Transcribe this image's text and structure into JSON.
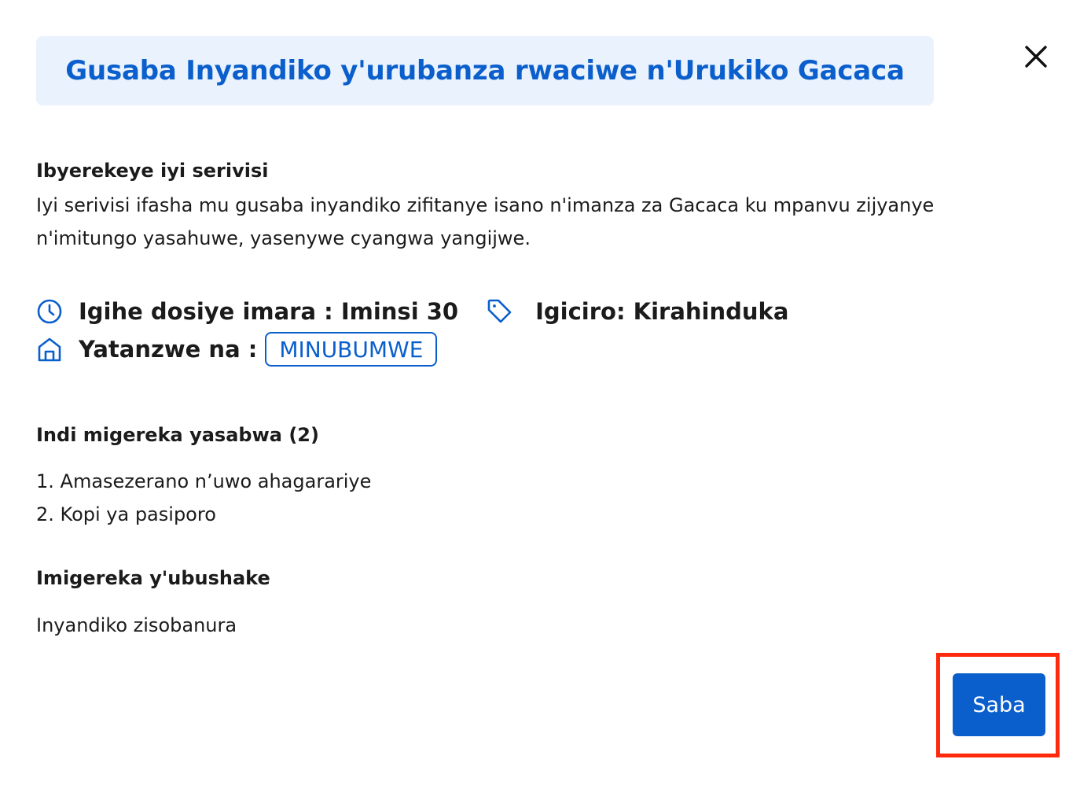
{
  "modal": {
    "title": "Gusaba Inyandiko y'urubanza rwaciwe n'Urukiko Gacaca",
    "close_icon": "close-icon"
  },
  "about": {
    "heading": "Ibyerekeye iyi serivisi",
    "description": "Iyi serivisi ifasha mu gusaba inyandiko zifitanye isano n'imanza za Gacaca ku mpanvu zijyanye n'imitungo yasahuwe, yasenywe cyangwa yangijwe."
  },
  "meta": {
    "duration_text": "Igihe dosiye imara : Iminsi 30",
    "price_text": "Igiciro: Kirahinduka",
    "provider_label": "Yatanzwe na :",
    "provider_badge": "MINUBUMWE",
    "icons": {
      "duration": "clock-icon",
      "price": "tag-icon",
      "provider": "home-icon"
    }
  },
  "requirements": {
    "heading": "Indi migereka yasabwa (2)",
    "items": [
      "1. Amasezerano n’uwo ahagarariye",
      "2. Kopi ya pasiporo"
    ]
  },
  "optional": {
    "heading": "Imigereka y'ubushake",
    "text": "Inyandiko zisobanura"
  },
  "actions": {
    "submit_label": "Saba"
  },
  "colors": {
    "accent": "#0a5fcc",
    "title_bg": "#eaf2fd",
    "highlight": "#ff2a0e"
  }
}
